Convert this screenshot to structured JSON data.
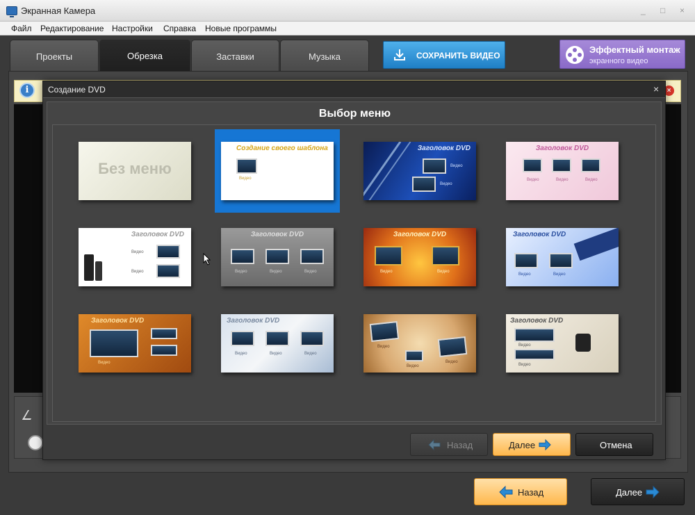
{
  "window": {
    "title": "Экранная Камера",
    "controls": [
      "_",
      "□",
      "×"
    ]
  },
  "menu": [
    "Файл",
    "Редактирование",
    "Настройки",
    "Справка",
    "Новые программы"
  ],
  "tabs": [
    "Проекты",
    "Обрезка",
    "Заставки",
    "Музыка"
  ],
  "active_tab": "Обрезка",
  "save_button": {
    "label": "СОХРАНИТЬ ВИДЕО",
    "icon": "download-icon",
    "color": "#2a8ad4"
  },
  "promo": {
    "title": "Эффектный монтаж",
    "subtitle": "экранного видео",
    "icon": "film-reel-icon",
    "color": "#9a7ad0"
  },
  "info_bar": {
    "icon": "info-icon",
    "close_icon": "close-icon"
  },
  "dialog": {
    "title": "Создание DVD",
    "close": "×",
    "heading": "Выбор меню",
    "selected_index": 1,
    "templates": [
      {
        "title": "Без меню",
        "style": "none"
      },
      {
        "title": "Создание своего шаблона",
        "caption": "Видео",
        "style": "custom"
      },
      {
        "title": "Заголовок DVD",
        "captions": [
          "Видео",
          "Видео"
        ],
        "style": "blue-rays"
      },
      {
        "title": "Заголовок DVD",
        "captions": [
          "Видео",
          "Видео",
          "Видео"
        ],
        "style": "pink"
      },
      {
        "title": "Заголовок DVD",
        "captions": [
          "Видео",
          "Видео"
        ],
        "style": "speakers"
      },
      {
        "title": "Заголовок DVD",
        "captions": [
          "Видео",
          "Видео",
          "Видео"
        ],
        "style": "gray"
      },
      {
        "title": "Заголовок DVD",
        "captions": [
          "Видео",
          "Видео"
        ],
        "style": "sparkle"
      },
      {
        "title": "Заголовок DVD",
        "captions": [
          "Видео",
          "Видео"
        ],
        "style": "filmstrip"
      },
      {
        "title": "Заголовок DVD",
        "captions": [
          "Видео"
        ],
        "style": "orange-paper"
      },
      {
        "title": "Заголовок DVD",
        "captions": [
          "Видео",
          "Видео",
          "Видео"
        ],
        "style": "frost"
      },
      {
        "title": "",
        "captions": [
          "Видео",
          "Видео",
          "Видео"
        ],
        "style": "scrapbook"
      },
      {
        "title": "Заголовок DVD",
        "captions": [
          "Видео",
          "Видео"
        ],
        "style": "ink"
      }
    ],
    "buttons": {
      "back": "Назад",
      "next": "Далее",
      "cancel": "Отмена"
    }
  },
  "bottom_buttons": {
    "back": "Назад",
    "next": "Далее"
  },
  "colors": {
    "accent_orange": "#ffc978",
    "accent_blue": "#2a8ad4",
    "selection": "#1676d4",
    "dialog_bg": "#3b3b3b"
  }
}
